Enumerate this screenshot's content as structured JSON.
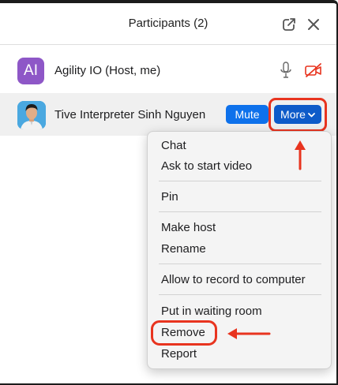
{
  "header": {
    "title": "Participants (2)"
  },
  "participants": [
    {
      "avatar_initials": "AI",
      "avatar_color": "#8e57c7",
      "name": "Agility IO (Host, me)"
    },
    {
      "name": "Tive Interpreter Sinh Nguyen",
      "mute_label": "Mute",
      "more_label": "More"
    }
  ],
  "menu": {
    "groups": [
      [
        "Chat",
        "Ask to start video"
      ],
      [
        "Pin"
      ],
      [
        "Make host",
        "Rename"
      ],
      [
        "Allow to record to computer"
      ],
      [
        "Put in waiting room",
        "Remove",
        "Report"
      ]
    ]
  },
  "colors": {
    "accent": "#0e71eb",
    "more_button": "#0e5bc9",
    "annotation": "#e8341f",
    "camera_off": "#e8341f"
  }
}
